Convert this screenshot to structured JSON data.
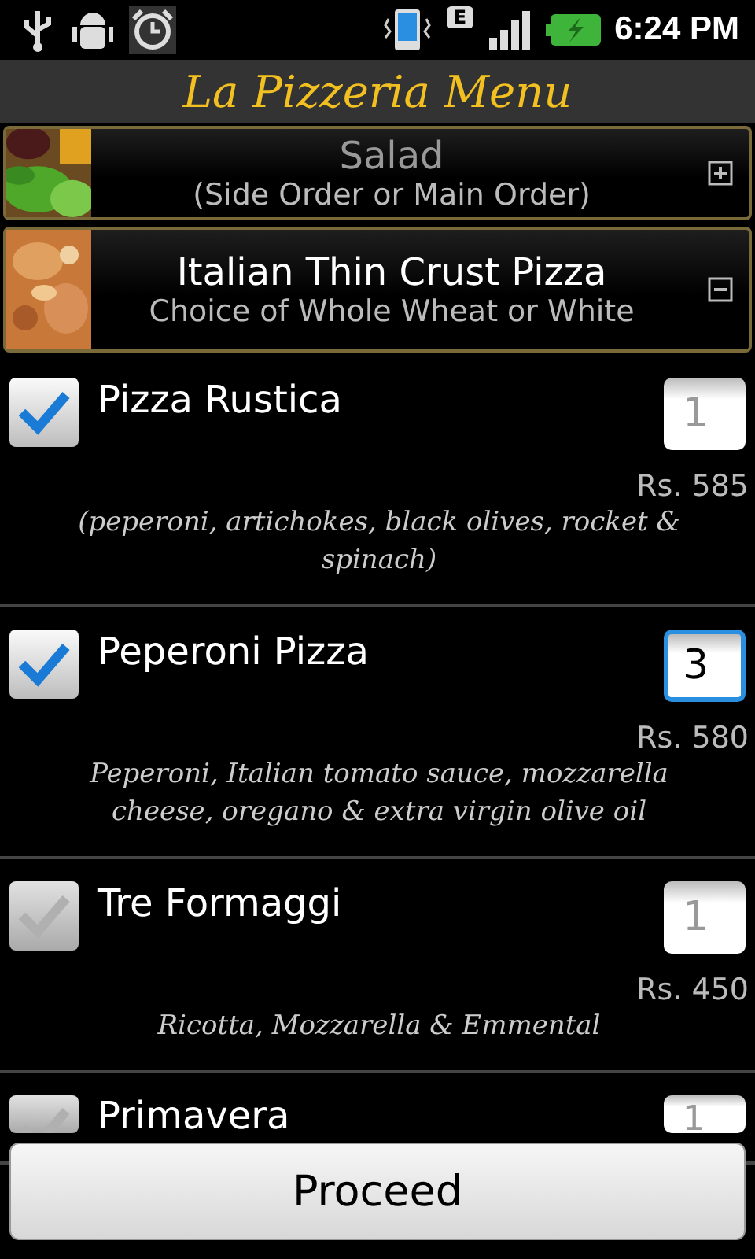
{
  "status_bar": {
    "time": "6:24 PM",
    "network": "E"
  },
  "title": "La Pizzeria Menu",
  "categories": [
    {
      "kind": "salad",
      "name": "Salad",
      "subtitle": "(Side Order or Main Order)",
      "expanded": false
    },
    {
      "kind": "pizza",
      "name": "Italian Thin Crust Pizza",
      "subtitle": "Choice of Whole Wheat or White",
      "expanded": true
    }
  ],
  "items": [
    {
      "name": "Pizza Rustica",
      "checked": true,
      "quantity": "1",
      "focused": false,
      "price": "Rs. 585",
      "description": "(peperoni, artichokes, black olives, rocket & spinach)"
    },
    {
      "name": "Peperoni Pizza",
      "checked": true,
      "quantity": "3",
      "focused": true,
      "price": "Rs. 580",
      "description": "Peperoni, Italian tomato sauce, mozzarella cheese, oregano & extra virgin olive oil"
    },
    {
      "name": "Tre Formaggi",
      "checked": false,
      "quantity": "1",
      "focused": false,
      "price": "Rs. 450",
      "description": "Ricotta, Mozzarella & Emmental"
    },
    {
      "name": "Primavera",
      "checked": false,
      "quantity": "1",
      "focused": false
    }
  ],
  "button": "Proceed"
}
